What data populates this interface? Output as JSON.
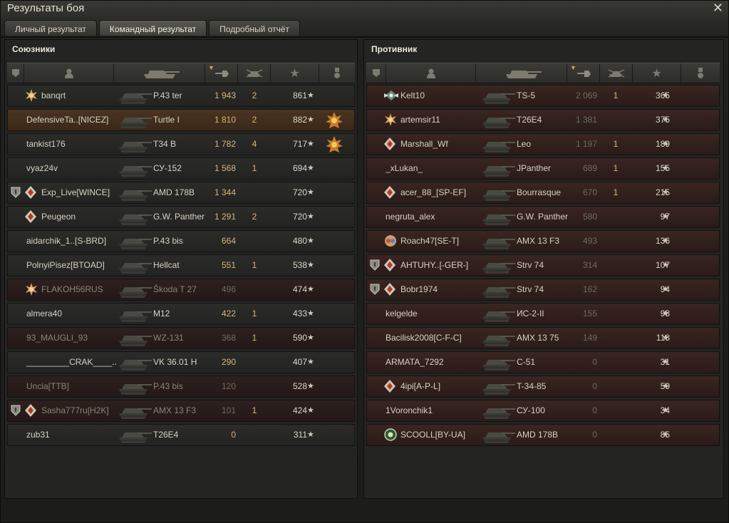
{
  "window": {
    "title": "Результаты боя"
  },
  "tabs": [
    {
      "label": "Личный результат"
    },
    {
      "label": "Командный результат"
    },
    {
      "label": "Подробный отчёт"
    }
  ],
  "allies": {
    "title": "Союзники",
    "rows": [
      {
        "name": "banqrt",
        "vehicle": "P.43 ter",
        "damage": "1 943",
        "kills": "2",
        "xp": "861",
        "badge": "gold-burst",
        "state": "alive"
      },
      {
        "name": "DefensiveTa..[NICEZ]",
        "vehicle": "Turtle I",
        "damage": "1 810",
        "kills": "2",
        "xp": "882",
        "medal": true,
        "state": "self"
      },
      {
        "name": "tankist176",
        "vehicle": "T34 B",
        "damage": "1 782",
        "kills": "4",
        "xp": "717",
        "medal": true,
        "state": "alive"
      },
      {
        "name": "vyaz24v",
        "vehicle": "СУ-152",
        "damage": "1 568",
        "kills": "1",
        "xp": "694",
        "state": "alive"
      },
      {
        "name": "Exp_Live[WINCE]",
        "vehicle": "AMD 178B",
        "damage": "1 344",
        "kills": "",
        "xp": "720",
        "platoon": true,
        "badge": "diamond",
        "state": "alive"
      },
      {
        "name": "Peugeon",
        "vehicle": "G.W. Panther",
        "damage": "1 291",
        "kills": "2",
        "xp": "720",
        "badge": "diamond",
        "state": "alive"
      },
      {
        "name": "aidarchik_1..[S-BRD]",
        "vehicle": "P.43 bis",
        "damage": "664",
        "kills": "",
        "xp": "480",
        "state": "alive"
      },
      {
        "name": "PolnyiPisez[BTOAD]",
        "vehicle": "Hellcat",
        "damage": "551",
        "kills": "1",
        "xp": "538",
        "state": "alive"
      },
      {
        "name": "FLAKOH56RUS",
        "vehicle": "Škoda T 27",
        "damage": "496",
        "kills": "",
        "xp": "474",
        "badge": "gold-burst",
        "state": "dead"
      },
      {
        "name": "almera40",
        "vehicle": "M12",
        "damage": "422",
        "kills": "1",
        "xp": "433",
        "state": "alive"
      },
      {
        "name": "93_MAUGLI_93",
        "vehicle": "WZ-131",
        "damage": "368",
        "kills": "1",
        "xp": "590",
        "state": "dead"
      },
      {
        "name": "_________CRAK____..",
        "vehicle": "VK 36.01 H",
        "damage": "290",
        "kills": "",
        "xp": "407",
        "state": "alive"
      },
      {
        "name": "Uncia[TTB]",
        "vehicle": "P.43 bis",
        "damage": "120",
        "kills": "",
        "xp": "528",
        "state": "dead"
      },
      {
        "name": "Sasha777ru[H2K]",
        "vehicle": "AMX 13 F3",
        "damage": "101",
        "kills": "1",
        "xp": "424",
        "platoon": true,
        "badge": "diamond",
        "state": "dead"
      },
      {
        "name": "zub31",
        "vehicle": "T26E4",
        "damage": "0",
        "kills": "",
        "xp": "311",
        "state": "alive"
      }
    ]
  },
  "enemies": {
    "title": "Противник",
    "rows": [
      {
        "name": "Kelt10",
        "vehicle": "TS-5",
        "damage": "2 069",
        "kills": "1",
        "xp": "365",
        "badge": "wings",
        "state": "dead"
      },
      {
        "name": "artemsir11",
        "vehicle": "T26E4",
        "damage": "1 381",
        "kills": "",
        "xp": "375",
        "badge": "gold-burst",
        "state": "dead"
      },
      {
        "name": "Marshall_Wf",
        "vehicle": "Leo",
        "damage": "1 197",
        "kills": "1",
        "xp": "189",
        "badge": "diamond",
        "state": "dead"
      },
      {
        "name": "_xLukan_",
        "vehicle": "JPanther",
        "damage": "689",
        "kills": "1",
        "xp": "155",
        "state": "dead"
      },
      {
        "name": "acer_88_[SP-EF]",
        "vehicle": "Bourrasque",
        "damage": "670",
        "kills": "1",
        "xp": "215",
        "badge": "diamond",
        "state": "dead"
      },
      {
        "name": "negruta_alex",
        "vehicle": "G.W. Panther",
        "damage": "580",
        "kills": "",
        "xp": "97",
        "state": "dead"
      },
      {
        "name": "Roach47[SE-T]",
        "vehicle": "AMX 13 F3",
        "damage": "493",
        "kills": "",
        "xp": "136",
        "badge": "multi",
        "state": "dead"
      },
      {
        "name": "AHTUHY..[-GER-]",
        "vehicle": "Strv 74",
        "damage": "314",
        "kills": "",
        "xp": "107",
        "platoon": true,
        "badge": "diamond",
        "state": "dead"
      },
      {
        "name": "Bobr1974",
        "vehicle": "Strv 74",
        "damage": "162",
        "kills": "",
        "xp": "94",
        "platoon": true,
        "badge": "diamond",
        "state": "dead"
      },
      {
        "name": "kelgelde",
        "vehicle": "ИС-2-II",
        "damage": "155",
        "kills": "",
        "xp": "98",
        "state": "dead"
      },
      {
        "name": "Bacilisk2008[C-F-C]",
        "vehicle": "AMX 13 75",
        "damage": "149",
        "kills": "",
        "xp": "118",
        "state": "dead"
      },
      {
        "name": "ARMATA_7292",
        "vehicle": "C-51",
        "damage": "0",
        "kills": "",
        "xp": "31",
        "state": "dead"
      },
      {
        "name": "4ipi[A-P-L]",
        "vehicle": "T-34-85",
        "damage": "0",
        "kills": "",
        "xp": "59",
        "badge": "diamond",
        "state": "dead"
      },
      {
        "name": "1Voronchik1",
        "vehicle": "СУ-100",
        "damage": "0",
        "kills": "",
        "xp": "34",
        "state": "dead"
      },
      {
        "name": "SCOOLL[BY-UA]",
        "vehicle": "AMD 178B",
        "damage": "0",
        "kills": "",
        "xp": "85",
        "badge": "green-ring",
        "state": "dead"
      }
    ]
  },
  "icons": {
    "header": [
      "platoon-icon",
      "player-icon",
      "tank-icon",
      "damage-icon",
      "kills-icon",
      "xp-star-icon",
      "medal-icon"
    ],
    "star_glyph": "★",
    "close_glyph": "✕"
  },
  "colors": {
    "damage_accent": "#d8b57c",
    "dead_row": "#3a2522",
    "self_row": "#4a3422"
  }
}
